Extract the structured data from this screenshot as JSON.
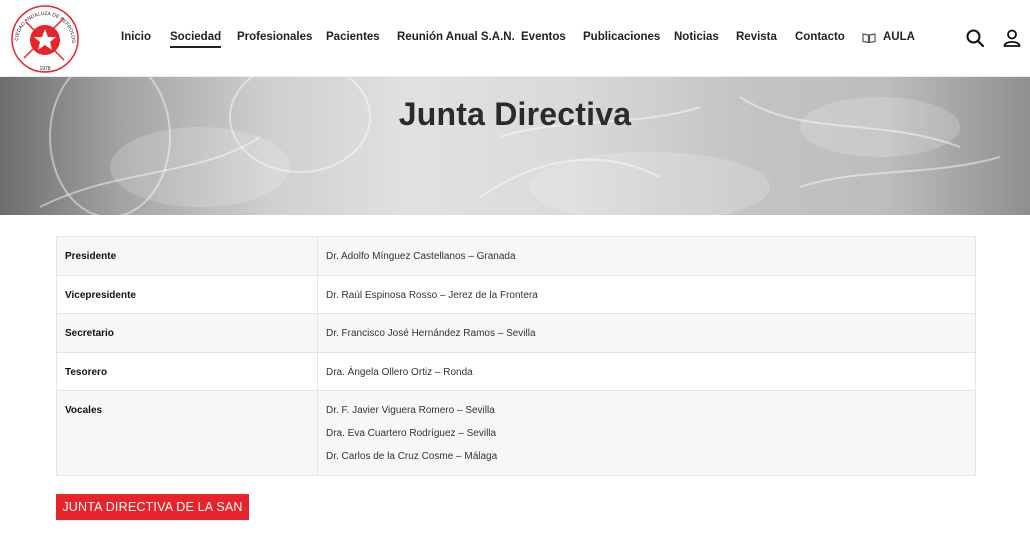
{
  "header": {
    "logo": {
      "ring_text": "SOCIEDAD ANDALUZA DE NEFROLOGIA",
      "year": "1978",
      "brand_color": "#e8232a"
    },
    "nav": [
      {
        "label": "Inicio"
      },
      {
        "label": "Sociedad",
        "active": true
      },
      {
        "label": "Profesionales"
      },
      {
        "label": "Pacientes"
      },
      {
        "label": "Reunión Anual S.A.N."
      },
      {
        "label": "Eventos"
      },
      {
        "label": "Publicaciones"
      },
      {
        "label": "Noticias"
      },
      {
        "label": "Revista"
      },
      {
        "label": "Contacto"
      },
      {
        "label": "AULA",
        "icon": "book-icon"
      }
    ],
    "icons": [
      "search-icon",
      "user-icon"
    ]
  },
  "hero": {
    "title": "Junta Directiva"
  },
  "board": {
    "rows": [
      {
        "role": "Presidente",
        "people": [
          "Dr. Adolfo Mínguez Castellanos – Granada"
        ]
      },
      {
        "role": "Vicepresidente",
        "people": [
          "Dr. Raúl Espinosa Rosso – Jerez de la Frontera"
        ]
      },
      {
        "role": "Secretario",
        "people": [
          "Dr. Francisco José Hernández Ramos – Sevilla"
        ]
      },
      {
        "role": "Tesorero",
        "people": [
          "Dra. Ángela Ollero Ortiz – Ronda"
        ]
      },
      {
        "role": "Vocales",
        "people": [
          "Dr. F. Javier Viguera Romero – Sevilla",
          "Dra. Eva Cuartero Rodríguez – Sevilla",
          "Dr. Carlos de la Cruz Cosme – Málaga"
        ]
      }
    ]
  },
  "cta": {
    "label": "JUNTA DIRECTIVA DE LA SAN",
    "color": "#e8232a"
  }
}
